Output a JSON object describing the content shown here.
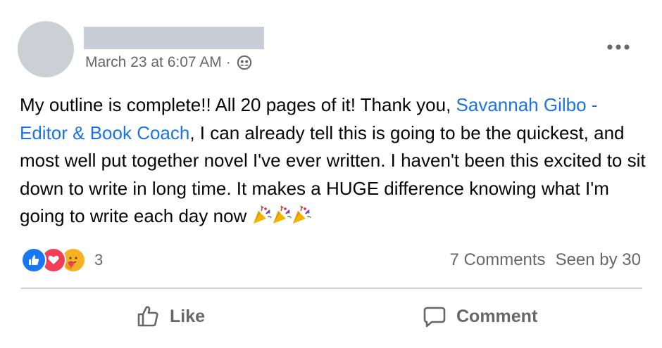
{
  "post": {
    "timestamp": "March 23 at 6:07 AM",
    "separator": "·",
    "audience_icon": "friends-icon",
    "text_part1": "My outline is complete!! All 20 pages of it! Thank you, ",
    "mention": "Savannah Gilbo - Editor & Book Coach",
    "text_part2": ", I can already tell this is going to be the quickest, and most well put together novel I've ever written. I haven't been this excited to sit down to write in long time. It makes a HUGE difference knowing what I'm going to write each day now ",
    "emojis": [
      "party-popper-icon",
      "party-popper-icon",
      "party-popper-icon"
    ]
  },
  "reactions": {
    "types": [
      "like-icon",
      "love-icon",
      "care-icon"
    ],
    "count": "3"
  },
  "stats": {
    "comments": "7 Comments",
    "seen_by": "Seen by 30"
  },
  "actions": {
    "like_label": "Like",
    "comment_label": "Comment"
  },
  "colors": {
    "link": "#1b74e4",
    "secondary_text": "#65676b",
    "like_blue": "#1877f2",
    "love_red": "#f33e58"
  }
}
